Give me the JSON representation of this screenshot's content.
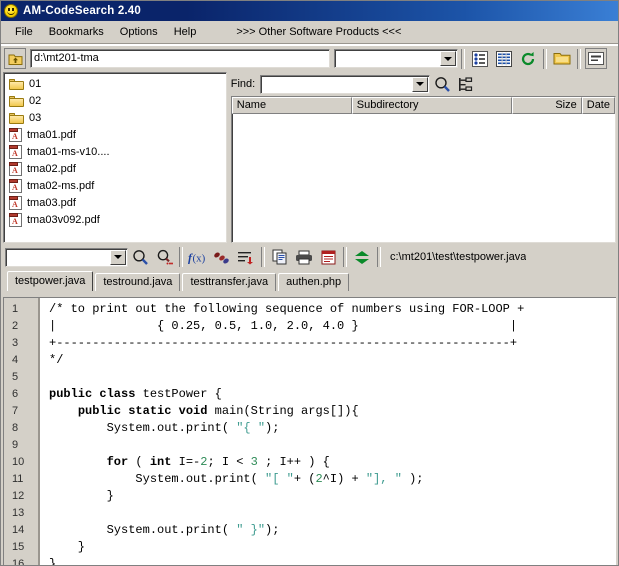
{
  "window": {
    "title": "AM-CodeSearch 2.40",
    "icon": "smiley-icon"
  },
  "menubar": {
    "items": [
      {
        "label": "File"
      },
      {
        "label": "Bookmarks"
      },
      {
        "label": "Options"
      },
      {
        "label": "Help"
      }
    ],
    "promo": ">>> Other Software Products <<<"
  },
  "toolbar_path": {
    "up_icon": "folder-up-icon",
    "path_value": "d:\\mt201-tma",
    "filter_value": "",
    "buttons": [
      {
        "name": "tree-view-icon"
      },
      {
        "name": "list-view-icon"
      },
      {
        "name": "refresh-icon"
      },
      {
        "name": "open-folder-icon"
      },
      {
        "name": "properties-icon"
      }
    ]
  },
  "file_list": {
    "items": [
      {
        "type": "folder",
        "name": "01"
      },
      {
        "type": "folder",
        "name": "02"
      },
      {
        "type": "folder",
        "name": "03"
      },
      {
        "type": "pdf",
        "name": "tma01.pdf"
      },
      {
        "type": "pdf",
        "name": "tma01-ms-v10...."
      },
      {
        "type": "pdf",
        "name": "tma02.pdf"
      },
      {
        "type": "pdf",
        "name": "tma02-ms.pdf"
      },
      {
        "type": "pdf",
        "name": "tma03.pdf"
      },
      {
        "type": "pdf",
        "name": "tma03v092.pdf"
      }
    ]
  },
  "find": {
    "label": "Find:",
    "value": "",
    "search_icon": "magnifier-icon",
    "tree_icon": "expand-tree-icon"
  },
  "results": {
    "columns": [
      "Name",
      "Subdirectory",
      "Size",
      "Date"
    ],
    "rows": []
  },
  "toolbar_code": {
    "search_value": "",
    "buttons": [
      {
        "name": "find-icon"
      },
      {
        "name": "find-next-icon"
      },
      {
        "name": "function-list-icon"
      },
      {
        "name": "bookmark-icon"
      },
      {
        "name": "goto-line-icon"
      },
      {
        "name": "copy-icon"
      },
      {
        "name": "print-icon"
      },
      {
        "name": "notepad-icon"
      },
      {
        "name": "sort-updown-icon"
      }
    ],
    "open_file_path": "c:\\mt201\\test\\testpower.java"
  },
  "tabs": [
    {
      "label": "testpower.java",
      "active": true
    },
    {
      "label": "testround.java",
      "active": false
    },
    {
      "label": "testtransfer.java",
      "active": false
    },
    {
      "label": "authen.php",
      "active": false
    }
  ],
  "editor": {
    "line_numbers": [
      "1",
      "2",
      "3",
      "4",
      "5",
      "6",
      "7",
      "8",
      "9",
      "10",
      "11",
      "12",
      "13",
      "14",
      "15",
      "16"
    ],
    "lines": [
      "/* to print out the following sequence of numbers using FOR-LOOP +",
      "|              { 0.25, 0.5, 1.0, 2.0, 4.0 }                     |",
      "+---------------------------------------------------------------+",
      "*/",
      "",
      "public class testPower {",
      "    public static void main(String args[]){",
      "        System.out.print( \"{ \");",
      "",
      "        for ( int I=-2; I < 3 ; I++ ) {",
      "            System.out.print( \"[ \"+ (2^I) + \"], \" );",
      "        }",
      "",
      "        System.out.print( \" }\");",
      "    }",
      "}"
    ]
  },
  "colors": {
    "titlebar": "#0a246a",
    "chrome": "#d4d0c8",
    "comment": "#9a9a33",
    "string": "#3d9b8f",
    "number": "#2e8b57",
    "accent_green": "#008000"
  }
}
